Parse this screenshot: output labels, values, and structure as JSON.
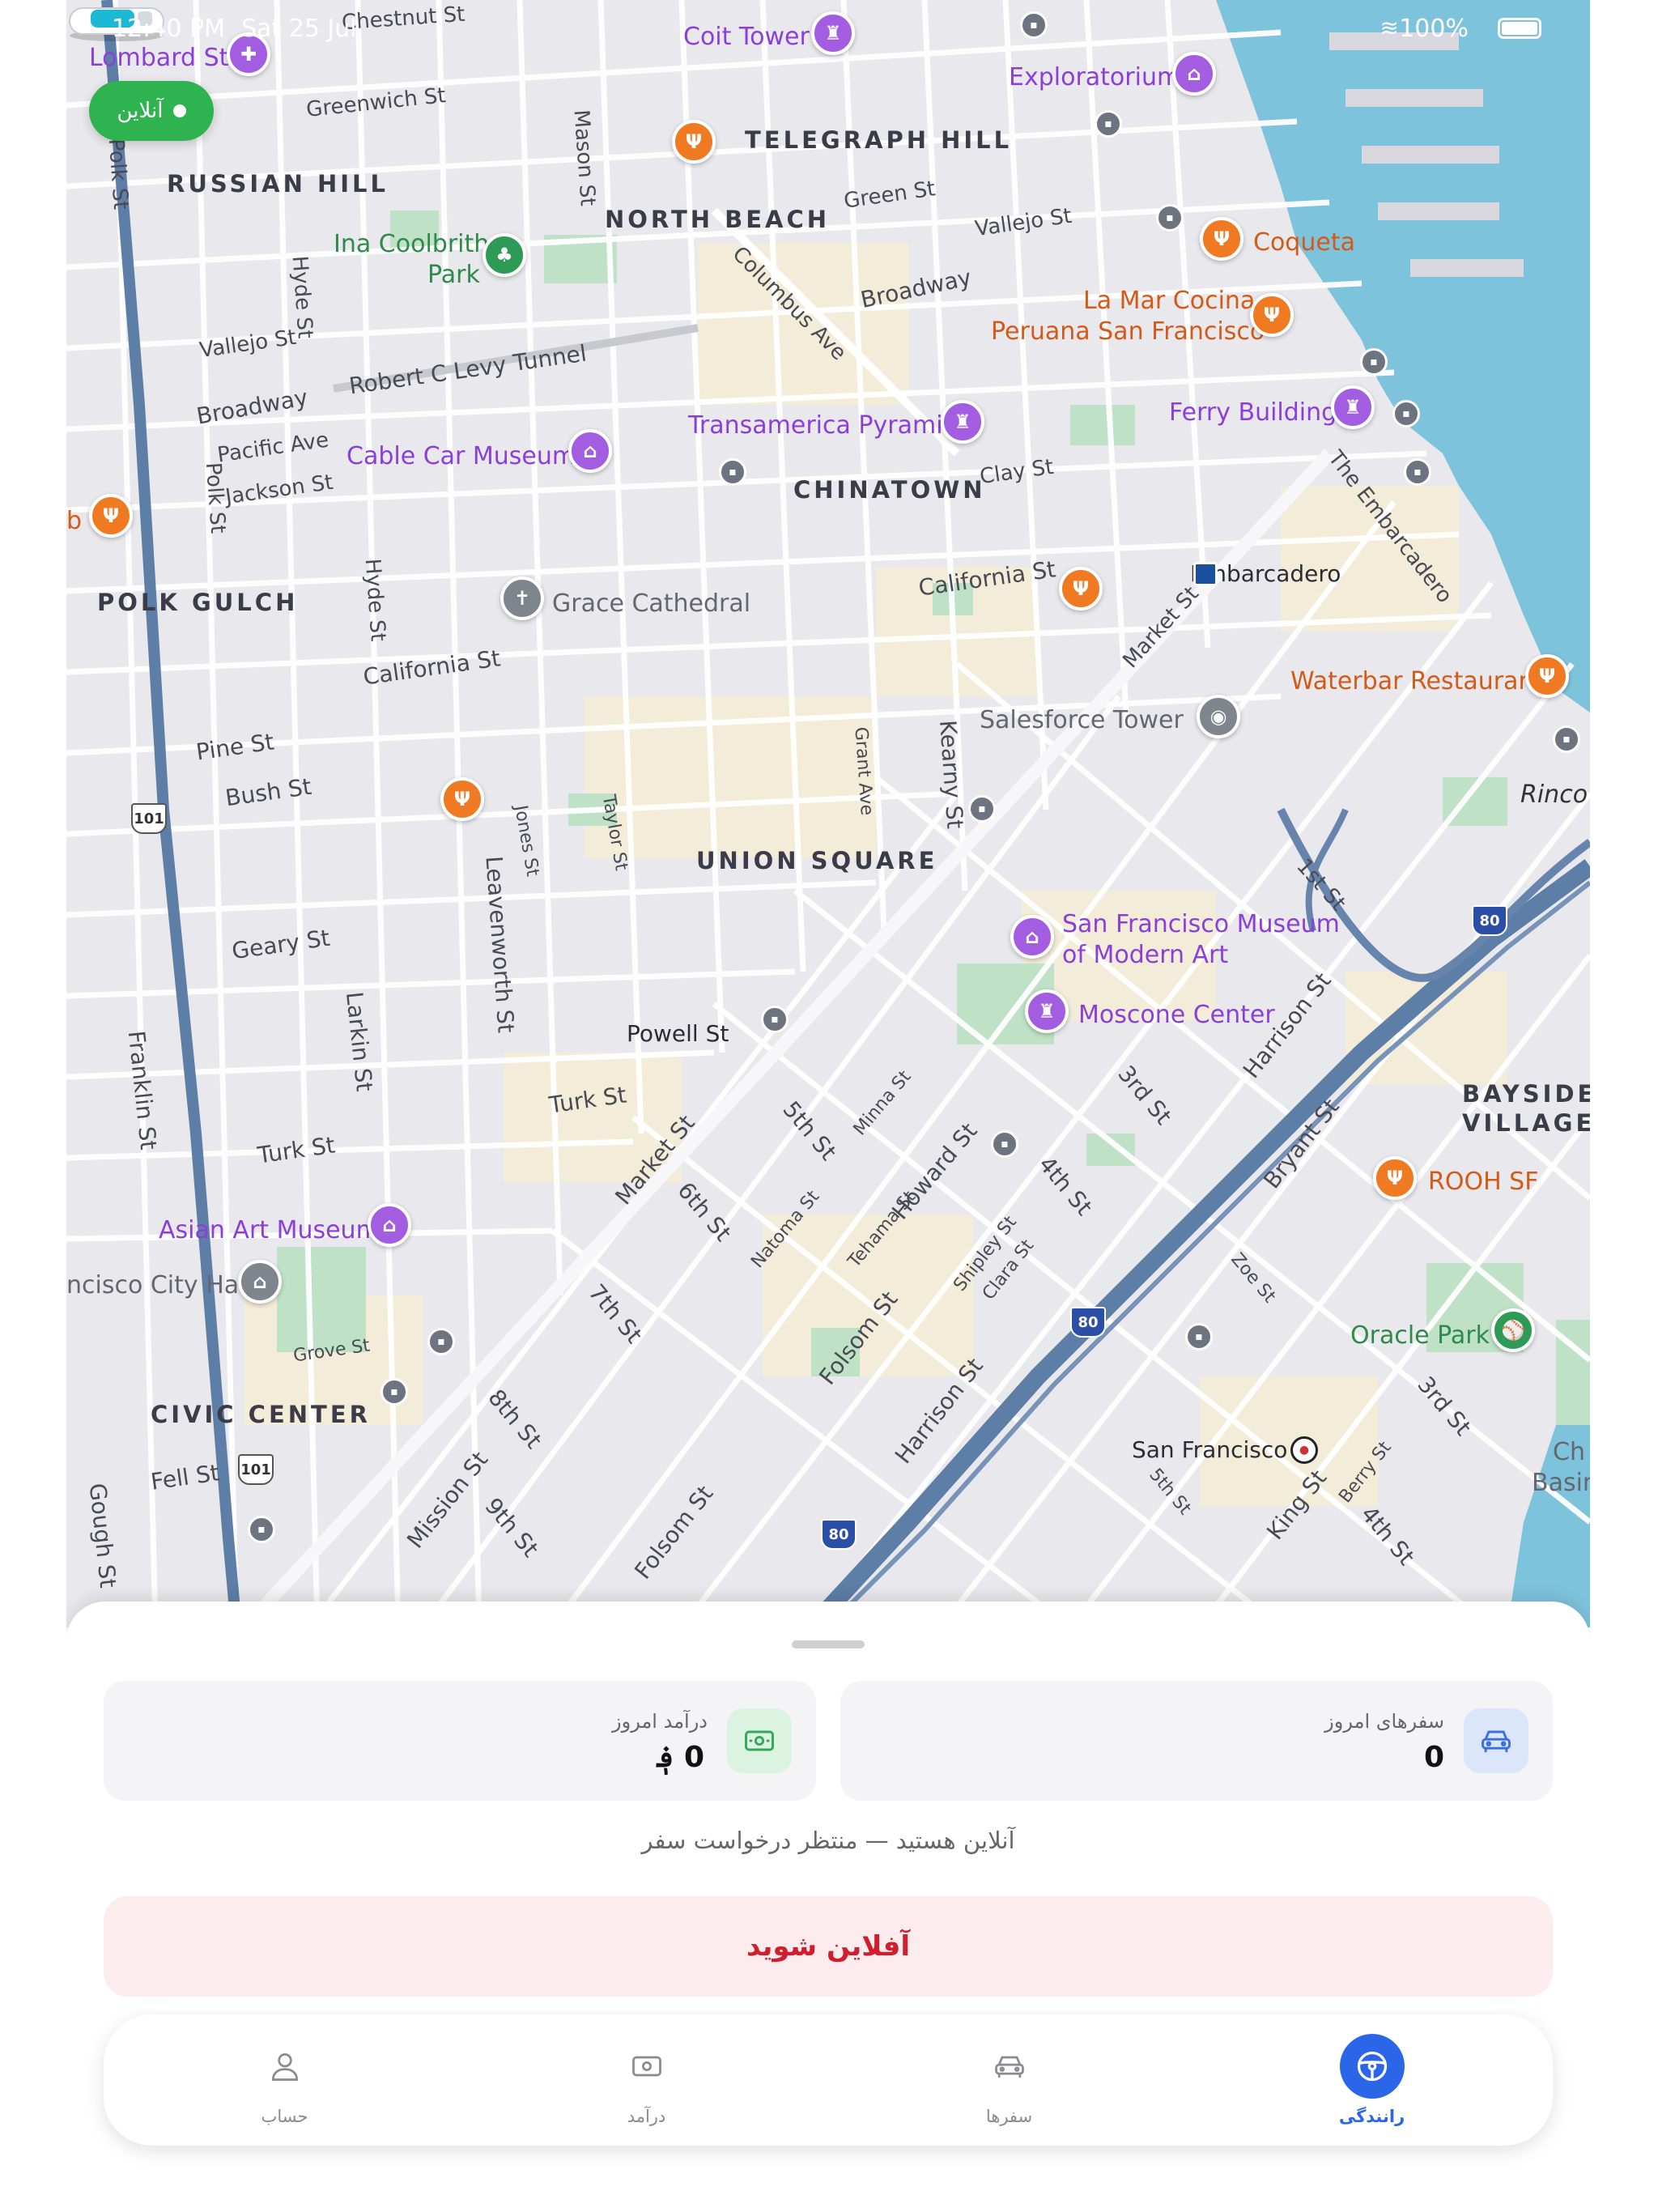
{
  "status_bar": {
    "time": "12:40 PM",
    "date": "Sat 25 Jul",
    "battery": "100%"
  },
  "online_badge": {
    "label": "آنلاین"
  },
  "map": {
    "neighborhoods": [
      "RUSSIAN HILL",
      "NORTH BEACH",
      "TELEGRAPH HILL",
      "CHINATOWN",
      "POLK GULCH",
      "UNION SQUARE",
      "CIVIC CENTER",
      "BAYSIDE",
      "VILLAGE"
    ],
    "streets": [
      "Lombard St",
      "Chestnut St",
      "Greenwich St",
      "Polk St",
      "Mason St",
      "Green St",
      "Vallejo St",
      "Hyde St",
      "Columbus Ave",
      "Broadway",
      "Robert C Levy Tunnel",
      "Pacific Ave",
      "Jackson St",
      "Clay St",
      "California St",
      "The Embarcadero",
      "Market St",
      "Pine St",
      "Bush St",
      "Jones St",
      "Taylor St",
      "Grant Ave",
      "Kearny St",
      "Geary St",
      "Leavenworth St",
      "Larkin St",
      "Franklin St",
      "1st St",
      "Harrison St",
      "3rd St",
      "Bryant St",
      "Turk St",
      "5th St",
      "Minna St",
      "Howard St",
      "6th St",
      "Natoma St",
      "Tehama St",
      "4th St",
      "Shipley St",
      "Clara St",
      "Zoe St",
      "7th St",
      "Folsom St",
      "Grove St",
      "8th St",
      "Mission St",
      "Fell St",
      "Gough St",
      "9th St",
      "King St",
      "Berry St"
    ],
    "pois": {
      "lombard_st": "Lombard St",
      "coit_tower": "Coit Tower",
      "exploratorium": "Exploratorium",
      "ina_coolbrith": "Ina Coolbrith",
      "park": "Park",
      "coqueta": "Coqueta",
      "la_mar_1": "La Mar Cocina",
      "la_mar_2": "Peruana San Francisco",
      "transamerica": "Transamerica Pyramid",
      "ferry_building": "Ferry Building",
      "cable_car": "Cable Car Museum",
      "embarcadero": "Embarcadero",
      "grace": "Grace Cathedral",
      "waterbar": "Waterbar Restaurant",
      "salesforce": "Salesforce Tower",
      "rinco": "Rinco",
      "sfmoma_1": "San Francisco Museum",
      "sfmoma_2": "of Modern Art",
      "moscone": "Moscone Center",
      "powell": "Powell St",
      "rooh": "ROOH SF",
      "asian_art": "Asian Art Museum",
      "city_hall": "ncisco City Hall",
      "oracle": "Oracle Park",
      "sf_station": "San Francisco",
      "ch": "Ch",
      "basin": "Basin",
      "b": "b"
    },
    "shields": [
      "101",
      "80",
      "80",
      "80",
      "101"
    ]
  },
  "sheet": {
    "trips_card": {
      "label": "سفرهای امروز",
      "value": "0",
      "icon": "car-icon"
    },
    "earnings_card": {
      "label": "درآمد امروز",
      "value": "0 ؋",
      "icon": "cash-icon"
    },
    "status_message": "آنلاین هستید — منتظر درخواست سفر",
    "offline_button": "آفلاین شوید"
  },
  "tabs": [
    {
      "label": "رانندگی",
      "icon": "steering-wheel-icon",
      "active": true
    },
    {
      "label": "سفرها",
      "icon": "car-icon",
      "active": false
    },
    {
      "label": "درآمد",
      "icon": "cash-icon",
      "active": false
    },
    {
      "label": "حساب",
      "icon": "user-icon",
      "active": false
    }
  ],
  "colors": {
    "accent": "#2b66e8",
    "online": "#2fb350",
    "danger": "#d11d2c",
    "danger_bg": "#fdecee",
    "water": "#7ec3dc"
  }
}
